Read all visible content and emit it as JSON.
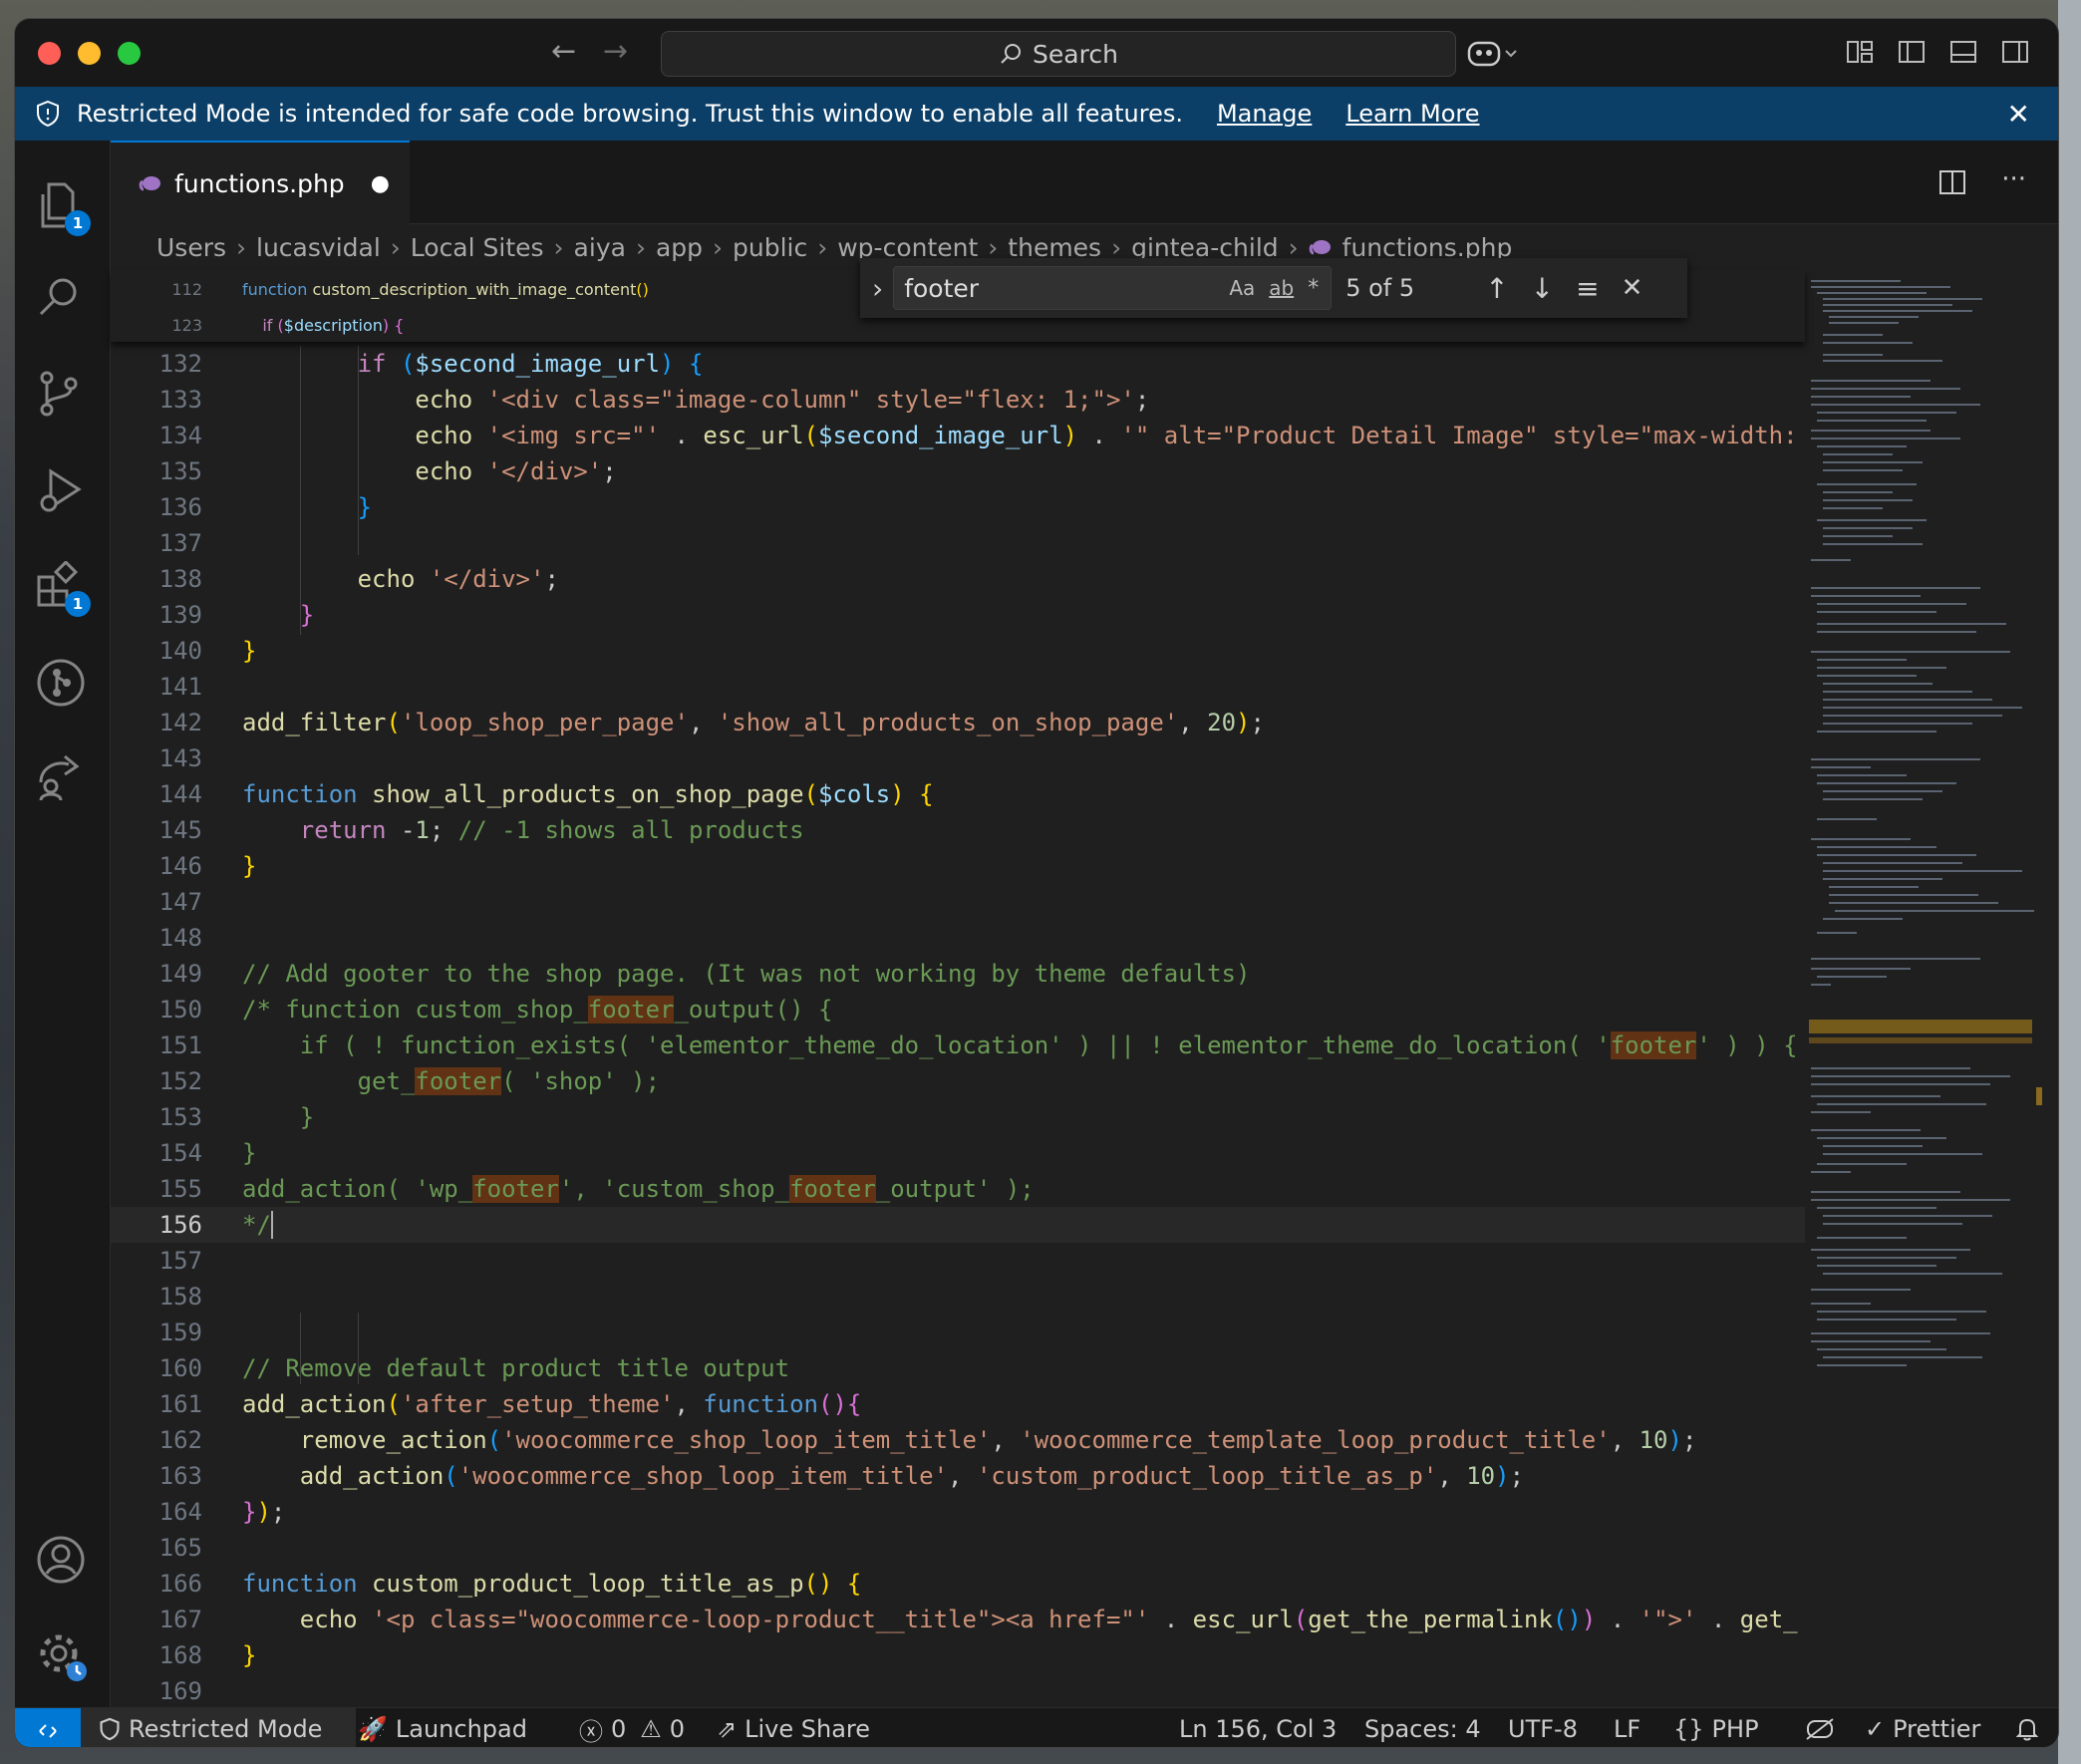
{
  "window": {
    "search_placeholder": "Search"
  },
  "banner": {
    "message": "Restricted Mode is intended for safe code browsing. Trust this window to enable all features.",
    "manage": "Manage",
    "learn_more": "Learn More"
  },
  "activity_bar": {
    "explorer_badge": "1",
    "extensions_badge": "1"
  },
  "tab": {
    "filename": "functions.php",
    "modified_dot": "●"
  },
  "breadcrumbs": [
    "Users",
    "lucasvidal",
    "Local Sites",
    "aiya",
    "app",
    "public",
    "wp-content",
    "themes",
    "gintea-child",
    "functions.php"
  ],
  "find_widget": {
    "query": "footer",
    "options": [
      "Aa",
      "ab",
      "*"
    ],
    "result": "5 of 5"
  },
  "sticky_lines": [
    {
      "num": "112",
      "html": "<span class='kw'>function</span> <span class='fn'>custom_description_with_image_content</span><span class='bk1'>()</span>"
    },
    {
      "num": "123",
      "html": "    <span class='ctl'>if</span> <span class='bk2'>(</span><span class='vr'>$description</span><span class='bk2'>)</span> <span class='bk2'>{</span>"
    }
  ],
  "code_lines": [
    {
      "num": "132",
      "html": "        <span class='ctl'>if</span> <span class='bk3'>(</span><span class='vr'>$second_image_url</span><span class='bk3'>)</span> <span class='bk3'>{</span>"
    },
    {
      "num": "133",
      "html": "            <span class='fn'>echo</span> <span class='st'>'&lt;div class=\"image-column\" style=\"flex: 1;\"&gt;'</span>;"
    },
    {
      "num": "134",
      "html": "            <span class='fn'>echo</span> <span class='st'>'&lt;img src=\"'</span> . <span class='fn'>esc_url</span><span class='bk1'>(</span><span class='vr'>$second_image_url</span><span class='bk1'>)</span> . <span class='st'>'\" alt=\"Product Detail Image\" style=\"max-width:</span>"
    },
    {
      "num": "135",
      "html": "            <span class='fn'>echo</span> <span class='st'>'&lt;/div&gt;'</span>;"
    },
    {
      "num": "136",
      "html": "        <span class='bk3'>}</span>"
    },
    {
      "num": "137",
      "html": ""
    },
    {
      "num": "138",
      "html": "        <span class='fn'>echo</span> <span class='st'>'&lt;/div&gt;'</span>;"
    },
    {
      "num": "139",
      "html": "    <span class='bk2'>}</span>"
    },
    {
      "num": "140",
      "html": "<span class='bk1'>}</span>"
    },
    {
      "num": "141",
      "html": ""
    },
    {
      "num": "142",
      "html": "<span class='fn'>add_filter</span><span class='bk1'>(</span><span class='st'>'loop_shop_per_page'</span>, <span class='st'>'show_all_products_on_shop_page'</span>, <span class='nm'>20</span><span class='bk1'>)</span>;"
    },
    {
      "num": "143",
      "html": ""
    },
    {
      "num": "144",
      "html": "<span class='kw'>function</span> <span class='fn'>show_all_products_on_shop_page</span><span class='bk1'>(</span><span class='vr'>$cols</span><span class='bk1'>)</span> <span class='bk1'>{</span>"
    },
    {
      "num": "145",
      "html": "    <span class='ctl'>return</span> -<span class='nm'>1</span>; <span class='cm'>// -1 shows all products</span>"
    },
    {
      "num": "146",
      "html": "<span class='bk1'>}</span>"
    },
    {
      "num": "147",
      "html": ""
    },
    {
      "num": "148",
      "html": ""
    },
    {
      "num": "149",
      "html": "<span class='cm'>// Add gooter to the shop page. (It was not working by theme defaults)</span>"
    },
    {
      "num": "150",
      "html": "<span class='cm'>/* function custom_shop_<span class='hl'>footer</span>_output() {</span>"
    },
    {
      "num": "151",
      "html": "<span class='cm'>    if ( ! function_exists( 'elementor_theme_do_location' ) || ! elementor_theme_do_location( '<span class='hl'>footer</span>' ) ) {</span>"
    },
    {
      "num": "152",
      "html": "<span class='cm'>        get_<span class='hl'>footer</span>( 'shop' );</span>"
    },
    {
      "num": "153",
      "html": "<span class='cm'>    }</span>"
    },
    {
      "num": "154",
      "html": "<span class='cm'>}</span>"
    },
    {
      "num": "155",
      "html": "<span class='cm'>add_action( 'wp_<span class='hl'>footer</span>', 'custom_shop_<span class='hl'>footer</span>_output' );</span>"
    },
    {
      "num": "156",
      "html": "<span class='cm'>*/</span><span style='border-left:2px solid #aeafad'></span>"
    },
    {
      "num": "157",
      "html": ""
    },
    {
      "num": "158",
      "html": ""
    },
    {
      "num": "159",
      "html": ""
    },
    {
      "num": "160",
      "html": "<span class='cm'>// Remove default product title output</span>"
    },
    {
      "num": "161",
      "html": "<span class='fn'>add_action</span><span class='bk1'>(</span><span class='st'>'after_setup_theme'</span>, <span class='kw'>function</span><span class='bk2'>()</span><span class='bk2'>{</span>"
    },
    {
      "num": "162",
      "html": "    <span class='fn'>remove_action</span><span class='bk3'>(</span><span class='st'>'woocommerce_shop_loop_item_title'</span>, <span class='st'>'woocommerce_template_loop_product_title'</span>, <span class='nm'>10</span><span class='bk3'>)</span>;"
    },
    {
      "num": "163",
      "html": "    <span class='fn'>add_action</span><span class='bk3'>(</span><span class='st'>'woocommerce_shop_loop_item_title'</span>, <span class='st'>'custom_product_loop_title_as_p'</span>, <span class='nm'>10</span><span class='bk3'>)</span>;"
    },
    {
      "num": "164",
      "html": "<span class='bk2'>}</span><span class='bk1'>)</span>;"
    },
    {
      "num": "165",
      "html": ""
    },
    {
      "num": "166",
      "html": "<span class='kw'>function</span> <span class='fn'>custom_product_loop_title_as_p</span><span class='bk1'>()</span> <span class='bk1'>{</span>"
    },
    {
      "num": "167",
      "html": "    <span class='fn'>echo</span> <span class='st'>'&lt;p class=\"woocommerce-loop-product__title\"&gt;&lt;a href=\"'</span> . <span class='fn'>esc_url</span><span class='bk2'>(</span><span class='fn'>get_the_permalink</span><span class='bk3'>()</span><span class='bk2'>)</span> . <span class='st'>'\"&gt;'</span> . <span class='fn'>get_</span>"
    },
    {
      "num": "168",
      "html": "<span class='bk1'>}</span>"
    },
    {
      "num": "169",
      "html": ""
    }
  ],
  "status": {
    "restricted": "Restricted Mode",
    "launchpad": "Launchpad",
    "errors": "0",
    "warnings": "0",
    "live_share": "Live Share",
    "position": "Ln 156, Col 3",
    "spaces": "Spaces: 4",
    "encoding": "UTF-8",
    "eol": "LF",
    "language": "PHP",
    "prettier": "Prettier"
  },
  "colors": {
    "accent": "#0078d4",
    "banner": "#0c3f67",
    "find_highlight": "#613214"
  }
}
